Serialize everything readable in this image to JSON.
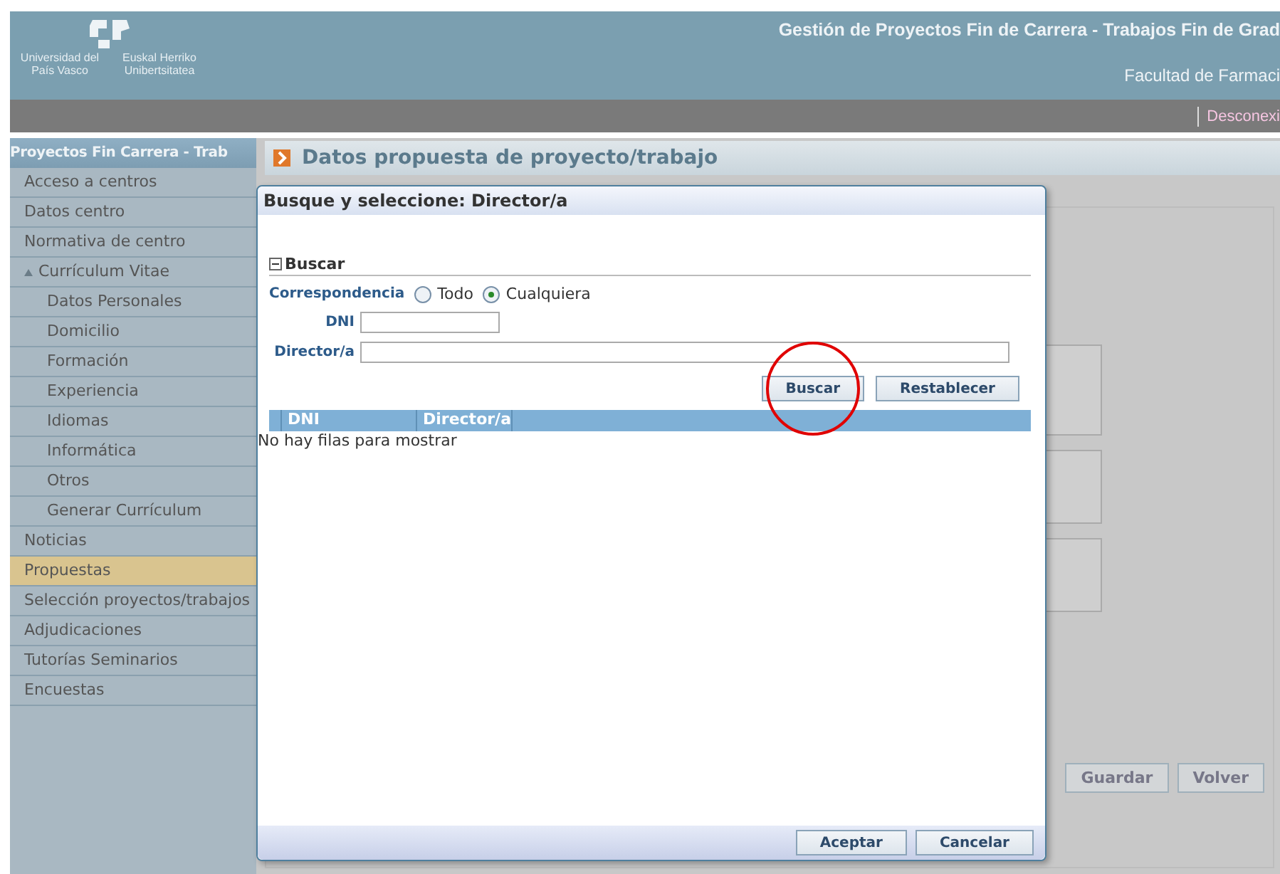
{
  "header": {
    "logo_texts": [
      "Universidad del País Vasco",
      "Euskal Herriko Unibertsitatea"
    ],
    "title": "Gestión de Proyectos Fin de Carrera - Trabajos Fin de Grad",
    "subtitle": "Facultad de Farmaci"
  },
  "top_bar": {
    "logout_link": "Desconexi"
  },
  "sidebar": {
    "title": "Proyectos Fin Carrera - Trab",
    "items": [
      {
        "label": "Acceso a centros",
        "selected": false
      },
      {
        "label": "Datos centro",
        "selected": false
      },
      {
        "label": "Normativa de centro",
        "selected": false
      },
      {
        "label": "Currículum Vitae",
        "selected": false,
        "expanded": true,
        "children": [
          {
            "label": "Datos Personales",
            "selected": false
          },
          {
            "label": "Domicilio",
            "selected": false
          },
          {
            "label": "Formación",
            "selected": false
          },
          {
            "label": "Experiencia",
            "selected": false
          },
          {
            "label": "Idiomas",
            "selected": false
          },
          {
            "label": "Informática",
            "selected": false
          },
          {
            "label": "Otros",
            "selected": false
          },
          {
            "label": "Generar Currículum",
            "selected": false
          }
        ]
      },
      {
        "label": "Noticias",
        "selected": false
      },
      {
        "label": "Propuestas",
        "selected": true
      },
      {
        "label": "Selección proyectos/trabajos",
        "selected": false
      },
      {
        "label": "Adjudicaciones",
        "selected": false
      },
      {
        "label": "Tutorías Seminarios",
        "selected": false
      },
      {
        "label": "Encuestas",
        "selected": false
      }
    ]
  },
  "content": {
    "title": "Datos propuesta de proyecto/trabajo",
    "buttons": [
      "Guardar",
      "Volver"
    ]
  },
  "dialog": {
    "title": "Busque y seleccione: Director/a",
    "section": {
      "label": "Buscar",
      "expanded": true
    },
    "match": {
      "label": "Correspondencia",
      "options": [
        {
          "label": "Todo",
          "selected": false
        },
        {
          "label": "Cualquiera",
          "selected": true
        }
      ]
    },
    "fields": [
      {
        "label": "DNI",
        "kind": "short"
      },
      {
        "label": "Director/a",
        "kind": "wide"
      }
    ],
    "search_buttons": [
      "Buscar",
      "Restablecer"
    ],
    "table": {
      "columns": [
        "DNI",
        "Director/a"
      ],
      "empty_message": "No hay filas para mostrar"
    },
    "footer_buttons": [
      "Aceptar",
      "Cancelar"
    ]
  }
}
